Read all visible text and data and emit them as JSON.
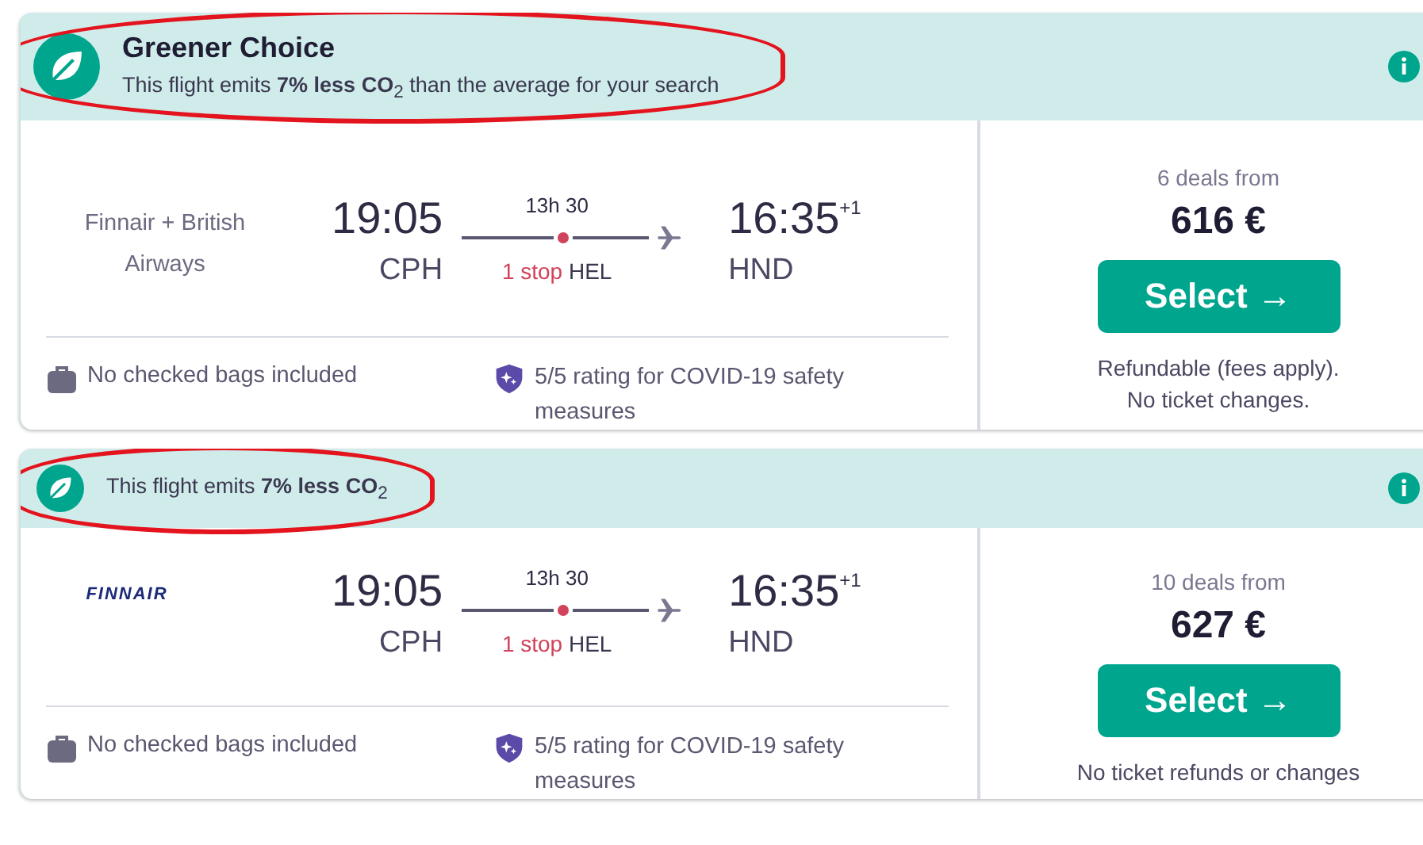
{
  "results": [
    {
      "banner": {
        "kind": "large",
        "title": "Greener Choice",
        "text": "This flight emits **7% less CO**$_{2}$ than the average for your search",
        "highlighted": true
      },
      "airline": {
        "kind": "text",
        "name": "Finnair + British Airways"
      },
      "flight": {
        "depart_time": "19:05",
        "depart_airport": "CPH",
        "duration": "13h 30",
        "stops": "1 stop",
        "via": "HEL",
        "arrive_time": "16:35",
        "day_offset": "+1",
        "arrive_airport": "HND"
      },
      "features": [
        "No checked bags included",
        "5/5 rating for COVID-19 safety measures"
      ],
      "deals": "6 deals from",
      "price": "616 €",
      "button": "Select →",
      "notes": [
        "Refundable (fees apply).",
        "No ticket changes."
      ]
    },
    {
      "banner": {
        "kind": "small",
        "text": "This flight emits **7% less CO**$_{2}$",
        "highlighted": true
      },
      "airline": {
        "kind": "logo",
        "name": "FINNAIR"
      },
      "flight": {
        "depart_time": "19:05",
        "depart_airport": "CPH",
        "duration": "13h 30",
        "stops": "1 stop",
        "via": "HEL",
        "arrive_time": "16:35",
        "day_offset": "+1",
        "arrive_airport": "HND"
      },
      "features": [
        "No checked bags included",
        "5/5 rating for COVID-19 safety measures"
      ],
      "deals": "10 deals from",
      "price": "627 €",
      "button": "Select →",
      "notes": [
        "No ticket refunds or changes"
      ]
    }
  ]
}
